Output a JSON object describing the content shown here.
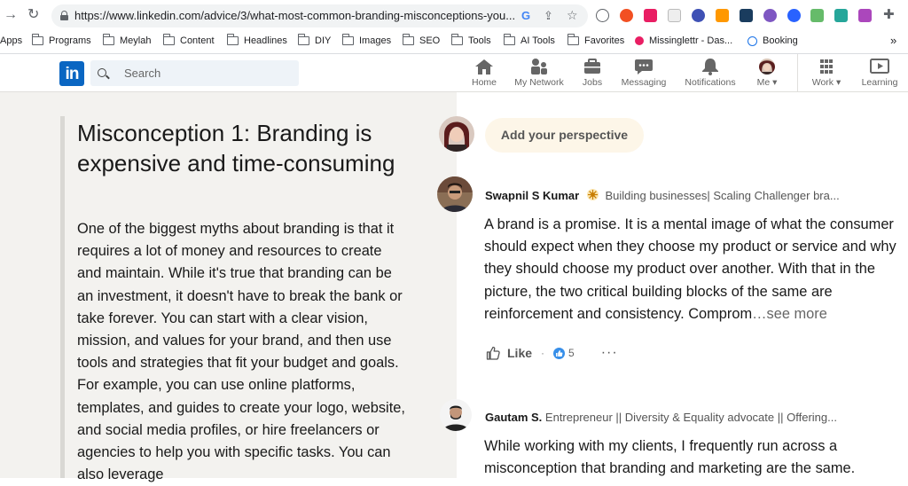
{
  "browser": {
    "url": "https://www.linkedin.com/advice/3/what-most-common-branding-misconceptions-you...",
    "bookmarks": [
      "Apps",
      "Programs",
      "Meylah",
      "Content",
      "Headlines",
      "DIY",
      "Images",
      "SEO",
      "Tools",
      "AI Tools",
      "Favorites",
      "Missinglettr - Das...",
      "Booking"
    ],
    "more_chevron": "»"
  },
  "linkedin": {
    "logo": "in",
    "search_placeholder": "Search",
    "nav": [
      {
        "label": "Home"
      },
      {
        "label": "My Network"
      },
      {
        "label": "Jobs"
      },
      {
        "label": "Messaging"
      },
      {
        "label": "Notifications"
      },
      {
        "label": "Me ▾"
      },
      {
        "label": "Work ▾"
      },
      {
        "label": "Learning"
      }
    ]
  },
  "article": {
    "title": "Misconception 1: Branding is expensive and time-consuming",
    "body": "One of the biggest myths about branding is that it requires a lot of money and resources to create and maintain. While it's true that branding can be an investment, it doesn't have to break the bank or take forever. You can start with a clear vision, mission, and values for your brand, and then use tools and strategies that fit your budget and goals. For example, you can use online platforms, templates, and guides to create your logo, website, and social media profiles, or hire freelancers or agencies to help you with specific tasks. You can also leverage"
  },
  "perspective": {
    "button_label": "Add your perspective"
  },
  "contributions": [
    {
      "name": "Swapnil S Kumar",
      "headline": "Building businesses| Scaling Challenger bra...",
      "text": "A brand is a promise. It is a mental image of what the consumer should expect when they choose my product or service and why they should choose my product over another. With that in the picture, the two critical building blocks of the same are reinforcement and consistency. Comprom",
      "see_more": "…see more",
      "like_label": "Like",
      "reaction_count": "5"
    },
    {
      "name": "Gautam S.",
      "headline": "Entrepreneur || Diversity & Equality advocate || Offering...",
      "text": "While working with my clients, I frequently run across a misconception that branding and marketing are the same."
    }
  ],
  "colors": {
    "linkedin_blue": "#0a66c2",
    "left_bg": "#f3f2ef",
    "perspective_bg": "#fdf6e8"
  }
}
